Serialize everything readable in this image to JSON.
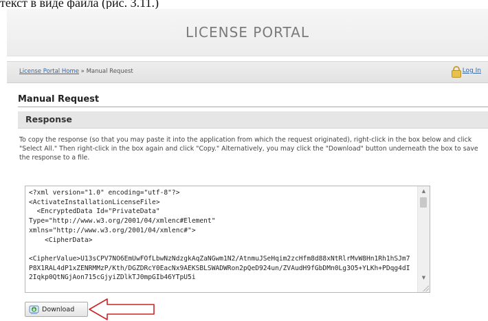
{
  "caption": "текст в виде файла (рис. 3.11.)",
  "header": {
    "title": "LICENSE PORTAL"
  },
  "breadcrumb": {
    "home_link": "License Portal Home",
    "separator": " » ",
    "current": "Manual Request"
  },
  "login": {
    "label": "Log In",
    "icon": "lock-icon"
  },
  "page": {
    "title": "Manual Request"
  },
  "section": {
    "title": "Response"
  },
  "instructions": "To copy the response (so that you may paste it into the application from which the request originated), right-click in the box below and click \"Select All.\" Then right-click in the box again and click \"Copy.\" Alternatively, you may click the \"Download\" button underneath the box to save the response to a file.",
  "response": {
    "text": "<?xml version=\"1.0\" encoding=\"utf-8\"?>\n<ActivateInstallationLicenseFile>\n  <EncryptedData Id=\"PrivateData\"\nType=\"http://www.w3.org/2001/04/xmlenc#Element\"\nxmlns=\"http://www.w3.org/2001/04/xmlenc#\">\n    <CipherData>\n\n<CipherValue>U13sCPV7NO6EmUwFOfLbwNzNdzgkAqZaNGwm1N2/AtnmuJSeHqim2zcHfm8d88xNtRlrMvW8Hn1Rh1hSJm7P8X1RAL4dP1xZENRMMzP/Kth/DGZDRcY0EacNx9AEKSBLSWADWRon2pQeD924un/ZVAudH9fGbDMn0Lg3O5+YLKh+PDqg4dI2Iqkp0QtNGjAon715cGjyiZDlkTJ0mpGIb46YTpU5i"
  },
  "download": {
    "label": "Download",
    "icon": "download-icon"
  },
  "colors": {
    "link": "#3366aa",
    "arrow": "#cc2222",
    "section_bg": "#e6e6e6"
  }
}
